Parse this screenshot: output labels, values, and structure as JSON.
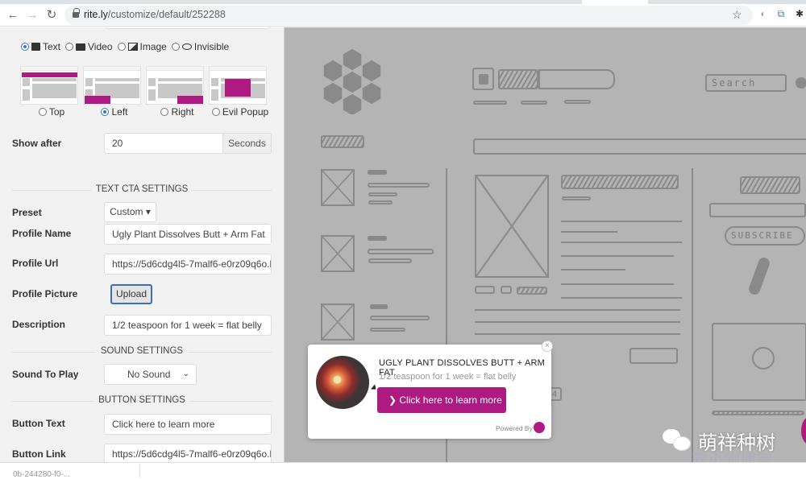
{
  "browser": {
    "url_host": "rite.ly",
    "url_path": "/customize/default/252288",
    "back_icon": "arrow-left",
    "forward_icon": "arrow-right",
    "reload_icon": "reload",
    "glyphs": {
      "back": "←",
      "forward": "→",
      "reload": "↻",
      "star": "☆",
      "ext1": "◐",
      "ext2": "⧉",
      "ext3": "✱"
    }
  },
  "sidebar": {
    "cta_types": [
      {
        "label": "Text",
        "selected": true,
        "icon": "text-square-icon"
      },
      {
        "label": "Video",
        "selected": false,
        "icon": "video-camera-icon"
      },
      {
        "label": "Image",
        "selected": false,
        "icon": "image-icon"
      },
      {
        "label": "Invisible",
        "selected": false,
        "icon": "eye-slash-icon"
      }
    ],
    "positions": [
      {
        "label": "Top",
        "selected": false
      },
      {
        "label": "Left",
        "selected": true
      },
      {
        "label": "Right",
        "selected": false
      },
      {
        "label": "Evil Popup",
        "selected": false
      }
    ],
    "show_after": {
      "label": "Show after",
      "value": "20",
      "unit": "Seconds"
    },
    "text_cta_section": "TEXT CTA SETTINGS",
    "preset": {
      "label": "Preset",
      "value": "Custom",
      "caret": "▾"
    },
    "profile_name": {
      "label": "Profile Name",
      "value": "Ugly Plant Dissolves Butt + Arm Fat"
    },
    "profile_url": {
      "label": "Profile Url",
      "value": "https://5d6cdg4l5-7malf6-e0rz09q6o.h"
    },
    "profile_picture": {
      "label": "Profile Picture",
      "button": "Upload"
    },
    "description": {
      "label": "Description",
      "value": "1/2 teaspoon for 1 week = flat belly"
    },
    "sound_section": "SOUND SETTINGS",
    "sound": {
      "label": "Sound To Play",
      "value": "No Sound",
      "caret": "⌄"
    },
    "button_section": "BUTTON SETTINGS",
    "button_text": {
      "label": "Button Text",
      "value": "Click here to learn more"
    },
    "button_link": {
      "label": "Button Link",
      "value": "https://5d6cdg4l5-7malf6-e0rz09q6o.h"
    }
  },
  "preview": {
    "sketch_search": "Search",
    "sketch_subscribe": "SUBSCRIBE",
    "sketch_page_num": "4",
    "popup": {
      "title": "UGLY PLANT DISSOLVES BUTT + ARM FAT",
      "description": "1/2 teaspoon for 1 week = flat belly",
      "button": "❯ Click here to learn more",
      "powered_by": "Powered By",
      "close": "×",
      "accent": "#ac1a82"
    }
  },
  "overlay": {
    "watermark_text": "萌祥种树",
    "watermark_site": "双小刚博客",
    "watermark_url": "shuangxiaogang.com"
  },
  "downloads": {
    "item": "0b-244280-f0-..."
  }
}
